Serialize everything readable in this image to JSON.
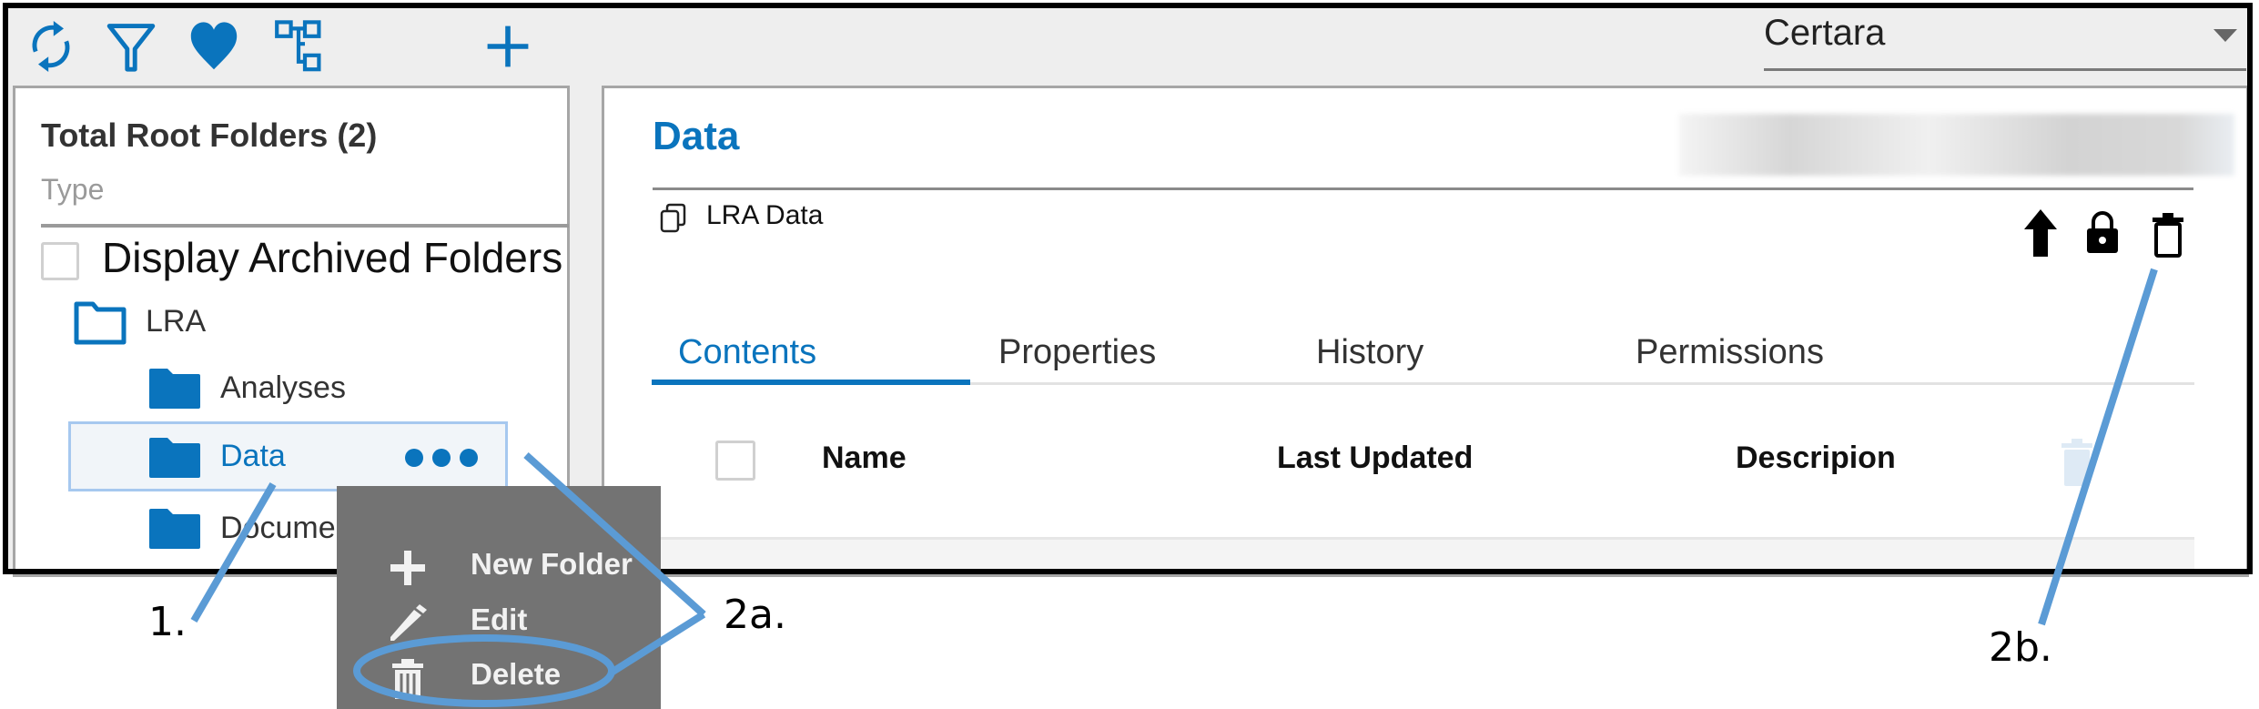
{
  "toolbar": {
    "icons": [
      "refresh-icon",
      "filter-icon",
      "favorites-heart-icon",
      "hierarchy-tree-icon",
      "add-plus-icon"
    ],
    "org_select": {
      "value": "Certara"
    }
  },
  "sidebar": {
    "title": "Total Root Folders (2)",
    "type_placeholder": "Type",
    "archived_checkbox_label": "Display Archived Folders",
    "archived_checked": false,
    "tree": {
      "root": {
        "label": "LRA"
      },
      "children": [
        {
          "label": "Analyses",
          "selected": false
        },
        {
          "label": "Data",
          "selected": true
        },
        {
          "label": "Documents",
          "selected": false,
          "visible_text": "Docume"
        }
      ]
    },
    "more_actions_label": "•••"
  },
  "context_menu": {
    "items": [
      {
        "label": "New Folder",
        "icon": "plus-icon"
      },
      {
        "label": "Edit",
        "icon": "pencil-icon"
      },
      {
        "label": "Delete",
        "icon": "trash-icon"
      }
    ]
  },
  "main": {
    "title": "Data",
    "subtitle": "LRA Data",
    "header_actions": [
      "upload-arrow-icon",
      "lock-icon",
      "delete-trash-icon"
    ],
    "tabs": [
      {
        "label": "Contents",
        "active": true
      },
      {
        "label": "Properties",
        "active": false
      },
      {
        "label": "History",
        "active": false
      },
      {
        "label": "Permissions",
        "active": false
      }
    ],
    "table": {
      "columns": [
        "Name",
        "Last Updated",
        "Descripion"
      ]
    }
  },
  "annotations": {
    "step1": "1.",
    "step2a": "2a.",
    "step2b": "2b."
  },
  "colors": {
    "accent": "#0a74bd",
    "annotation": "#5b9bd5",
    "menu_bg": "#737373"
  }
}
